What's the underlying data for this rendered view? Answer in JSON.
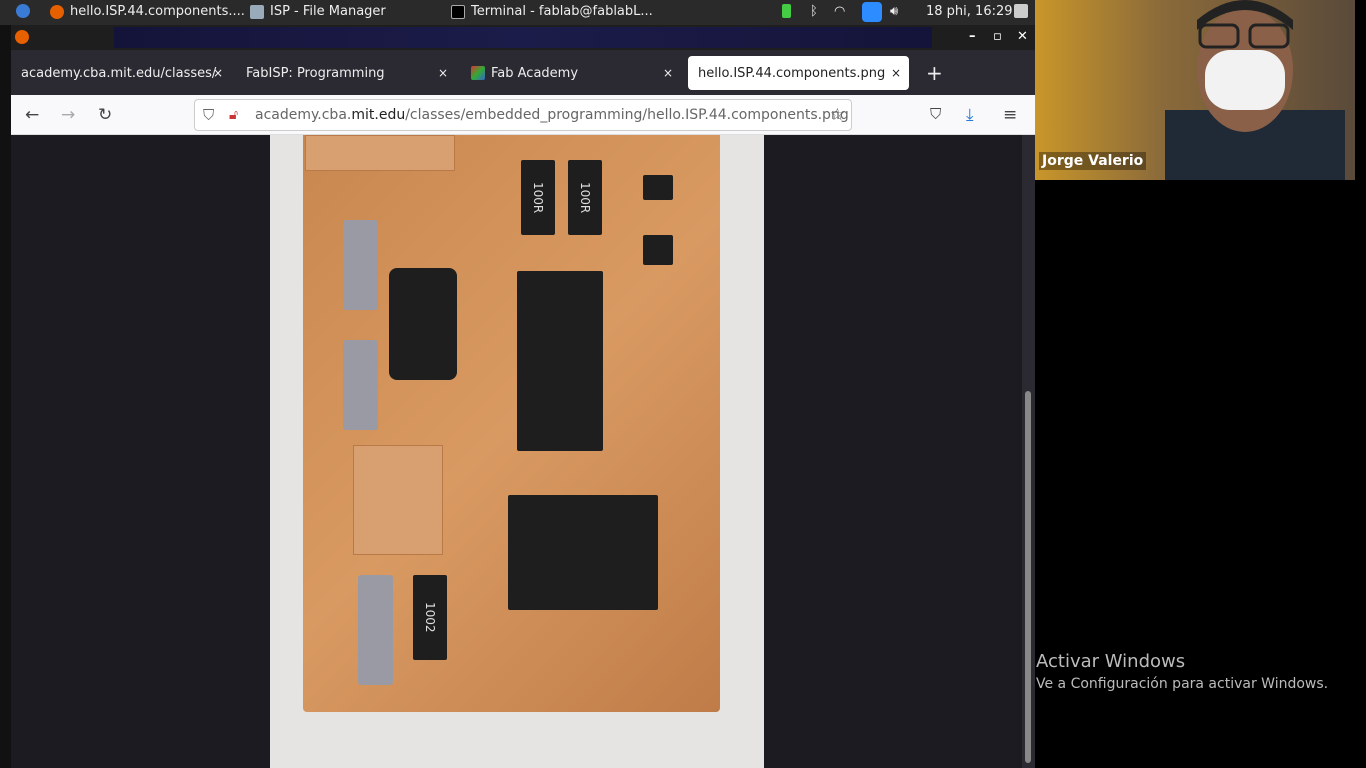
{
  "taskbar": {
    "items": [
      {
        "label": "hello.ISP.44.components...."
      },
      {
        "label": "ISP - File Manager"
      },
      {
        "label": "Terminal - fablab@fablabL..."
      }
    ],
    "clock": "18 phi, 16:29"
  },
  "browser": {
    "tabs": [
      {
        "label": "academy.cba.mit.edu/classes/"
      },
      {
        "label": "FabISP: Programming"
      },
      {
        "label": "Fab Academy"
      },
      {
        "label": "hello.ISP.44.components.png"
      }
    ],
    "close_glyph": "×",
    "new_tab_glyph": "+",
    "url": {
      "host_pre": "academy.cba.",
      "host_main": "mit.edu",
      "path": "/classes/embedded_programming/hello.ISP.44.components.png"
    },
    "image_labels": {
      "r1": "100R",
      "r2": "100R",
      "r3": "1002"
    }
  },
  "video": {
    "participant": "Jorge Valerio"
  },
  "watermark": {
    "title": "Activar Windows",
    "subtitle": "Ve a Configuración para activar Windows."
  }
}
